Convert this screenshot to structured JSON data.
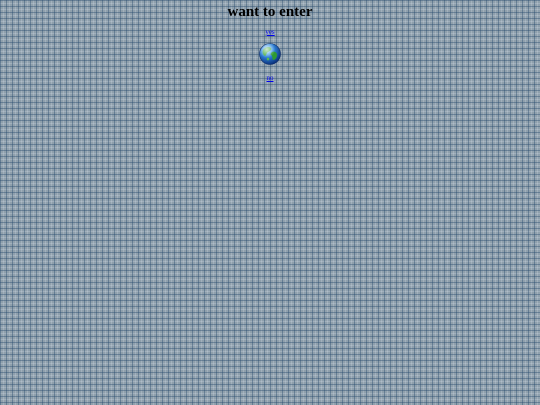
{
  "page": {
    "title": "want to enter",
    "yes_link": "yes",
    "no_link": "no",
    "globe_icon": "globe-icon"
  },
  "colors": {
    "background": "#8fa0ac",
    "grid_line": "#284b6e",
    "link": "#0000ee",
    "title_text": "#000000"
  }
}
